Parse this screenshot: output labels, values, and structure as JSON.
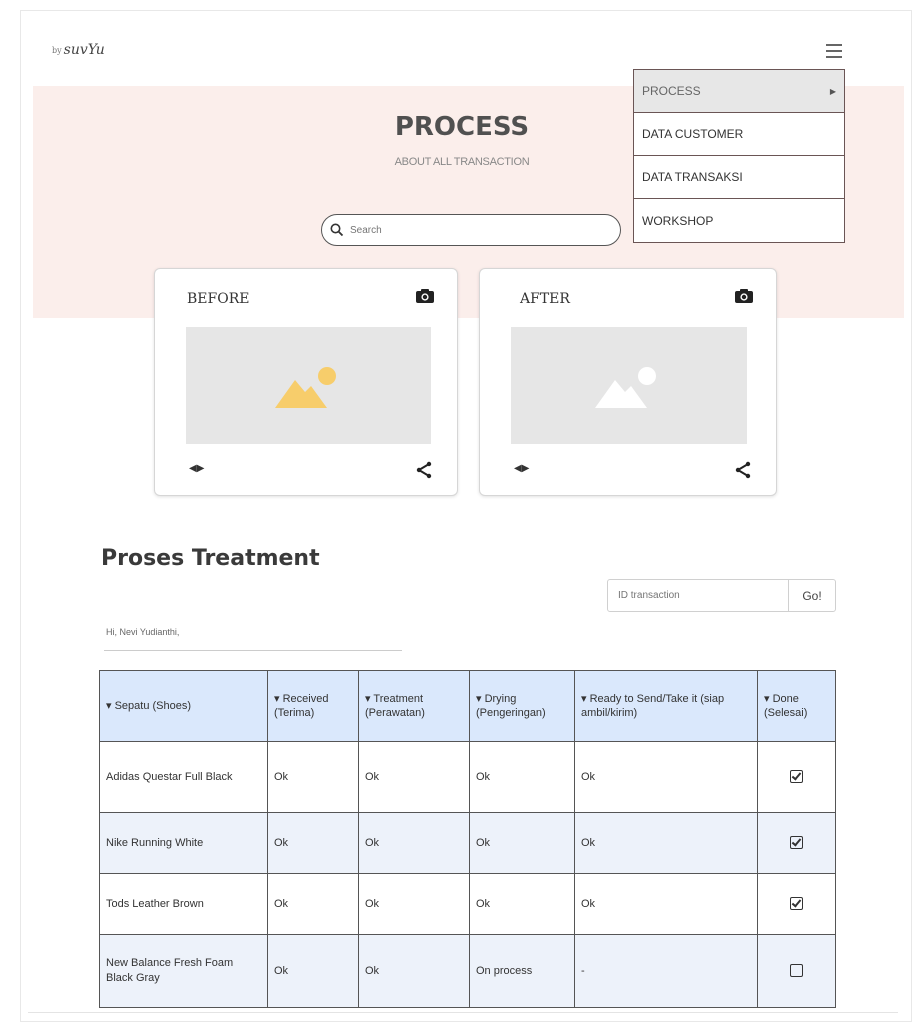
{
  "header": {
    "logo_small": "by",
    "logo_text": "suvYu"
  },
  "hero": {
    "title": "PROCESS",
    "subtitle": "ABOUT ALL TRANSACTION",
    "search_placeholder": "Search"
  },
  "menu": {
    "items": [
      {
        "label": "PROCESS",
        "active": true
      },
      {
        "label": "DATA CUSTOMER"
      },
      {
        "label": "DATA TRANSAKSI"
      },
      {
        "label": "WORKSHOP"
      }
    ]
  },
  "cards": {
    "before_label": "BEFORE",
    "after_label": "AFTER",
    "audio_symbol": "◀▶"
  },
  "treatment": {
    "title": "Proses Treatment",
    "id_placeholder": "ID transaction",
    "go_label": "Go!",
    "greeting": "Hi, Nevi Yudianthi,",
    "headers": [
      "▾ Sepatu (Shoes)",
      "▾ Received (Terima)",
      "▾ Treatment (Perawatan)",
      "▾ Drying (Pengeringan)",
      "▾ Ready to Send/Take it (siap ambil/kirim)",
      "▾ Done (Selesai)"
    ],
    "rows": [
      {
        "shoe": "Adidas Questar Full Black",
        "received": "Ok",
        "treatment": "Ok",
        "drying": "Ok",
        "ready": "Ok",
        "done": true
      },
      {
        "shoe": "Nike Running White",
        "received": "Ok",
        "treatment": "Ok",
        "drying": "Ok",
        "ready": "Ok",
        "done": true
      },
      {
        "shoe": "Tods Leather Brown",
        "received": "Ok",
        "treatment": "Ok",
        "drying": "Ok",
        "ready": "Ok",
        "done": true
      },
      {
        "shoe": "New Balance Fresh Foam Black Gray",
        "received": "Ok",
        "treatment": "Ok",
        "drying": "On process",
        "ready": "-",
        "done": false
      }
    ]
  },
  "colors": {
    "hero_bg": "#fbeeeb",
    "table_header": "#dae8fc",
    "image_placeholder_active": "#f7cd6b",
    "image_placeholder_inactive": "#ffffff"
  },
  "icons": {
    "menu": "hamburger-icon",
    "search": "search-icon",
    "camera": "camera-icon",
    "image": "image-placeholder-icon",
    "share": "share-icon",
    "checkbox": "checkbox-icon"
  }
}
